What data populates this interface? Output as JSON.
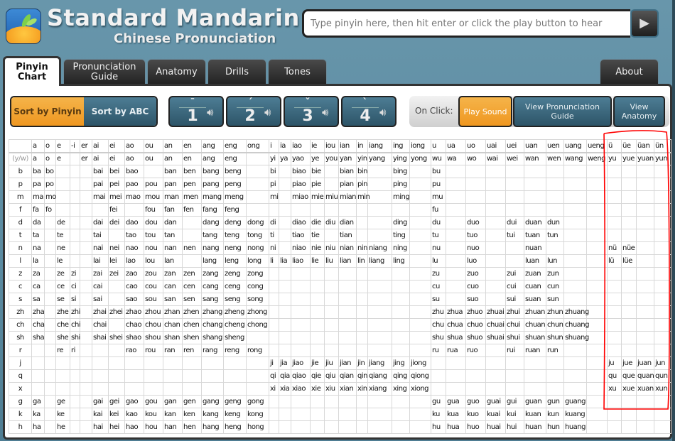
{
  "header": {
    "title": "Standard Mandarin",
    "subtitle": "Chinese Pronunciation",
    "search_placeholder": "Type pinyin here, then hit enter or click the play button to hear",
    "play_icon": "play-icon"
  },
  "tabs": [
    {
      "label": "Pinyin Chart",
      "active": true
    },
    {
      "label": "Pronunciation Guide"
    },
    {
      "label": "Anatomy"
    },
    {
      "label": "Drills"
    },
    {
      "label": "Tones"
    },
    {
      "label": "About"
    }
  ],
  "sort": {
    "pinyin": "Sort by Pinyin",
    "abc": "Sort by ABC",
    "selected": "pinyin"
  },
  "tones": [
    {
      "mark": "ˉ",
      "num": "1"
    },
    {
      "mark": "ˊ",
      "num": "2"
    },
    {
      "mark": "ˇ",
      "num": "3"
    },
    {
      "mark": "ˋ",
      "num": "4"
    }
  ],
  "on_click": {
    "label": "On Click:",
    "options": [
      "Play Sound",
      "View Pronunciation Guide",
      "View Anatomy"
    ],
    "selected": "Play Sound"
  },
  "colors": {
    "accent": "#ef9720",
    "button_blue": "#3a6679",
    "annotation": "#ff0000"
  },
  "chart": {
    "finals": [
      "a",
      "o",
      "e",
      "-i",
      "er",
      "ai",
      "ei",
      "ao",
      "ou",
      "an",
      "en",
      "ang",
      "eng",
      "ong",
      "i",
      "ia",
      "iao",
      "ie",
      "iou",
      "ian",
      "in",
      "iang",
      "ing",
      "iong",
      "u",
      "ua",
      "uo",
      "uai",
      "uei",
      "uan",
      "uen",
      "uang",
      "ueng",
      "ü",
      "üe",
      "üan",
      "ün"
    ],
    "rows": [
      {
        "initial": "(y/w)",
        "cells": [
          "a",
          "o",
          "e",
          "",
          "er",
          "ai",
          "ei",
          "ao",
          "ou",
          "an",
          "en",
          "ang",
          "eng",
          "",
          "yi",
          "ya",
          "yao",
          "ye",
          "you",
          "yan",
          "yin",
          "yang",
          "ying",
          "yong",
          "wu",
          "wa",
          "wo",
          "wai",
          "wei",
          "wan",
          "wen",
          "wang",
          "weng",
          "yu",
          "yue",
          "yuan",
          "yun"
        ]
      },
      {
        "initial": "b",
        "cells": [
          "ba",
          "bo",
          "",
          "",
          "",
          "bai",
          "bei",
          "bao",
          "",
          "ban",
          "ben",
          "bang",
          "beng",
          "",
          "bi",
          "",
          "biao",
          "bie",
          "",
          "bian",
          "bin",
          "",
          "bing",
          "",
          "bu",
          "",
          "",
          "",
          "",
          "",
          "",
          "",
          "",
          "",
          "",
          "",
          ""
        ]
      },
      {
        "initial": "p",
        "cells": [
          "pa",
          "po",
          "",
          "",
          "",
          "pai",
          "pei",
          "pao",
          "pou",
          "pan",
          "pen",
          "pang",
          "peng",
          "",
          "pi",
          "",
          "piao",
          "pie",
          "",
          "pian",
          "pin",
          "",
          "ping",
          "",
          "pu",
          "",
          "",
          "",
          "",
          "",
          "",
          "",
          "",
          "",
          "",
          "",
          ""
        ]
      },
      {
        "initial": "m",
        "cells": [
          "ma",
          "mo",
          "",
          "",
          "",
          "mai",
          "mei",
          "mao",
          "mou",
          "man",
          "men",
          "mang",
          "meng",
          "",
          "mi",
          "",
          "miao",
          "mie",
          "miu",
          "mian",
          "min",
          "",
          "ming",
          "",
          "mu",
          "",
          "",
          "",
          "",
          "",
          "",
          "",
          "",
          "",
          "",
          "",
          ""
        ]
      },
      {
        "initial": "f",
        "cells": [
          "fa",
          "fo",
          "",
          "",
          "",
          "",
          "fei",
          "",
          "fou",
          "fan",
          "fen",
          "fang",
          "feng",
          "",
          "",
          "",
          "",
          "",
          "",
          "",
          "",
          "",
          "",
          "",
          "fu",
          "",
          "",
          "",
          "",
          "",
          "",
          "",
          "",
          "",
          "",
          "",
          ""
        ]
      },
      {
        "initial": "d",
        "cells": [
          "da",
          "",
          "de",
          "",
          "",
          "dai",
          "dei",
          "dao",
          "dou",
          "dan",
          "",
          "dang",
          "deng",
          "dong",
          "di",
          "",
          "diao",
          "die",
          "diu",
          "dian",
          "",
          "",
          "ding",
          "",
          "du",
          "",
          "duo",
          "",
          "dui",
          "duan",
          "dun",
          "",
          "",
          "",
          "",
          "",
          ""
        ]
      },
      {
        "initial": "t",
        "cells": [
          "ta",
          "",
          "te",
          "",
          "",
          "tai",
          "",
          "tao",
          "tou",
          "tan",
          "",
          "tang",
          "teng",
          "tong",
          "ti",
          "",
          "tiao",
          "tie",
          "",
          "tian",
          "",
          "",
          "ting",
          "",
          "tu",
          "",
          "tuo",
          "",
          "tui",
          "tuan",
          "tun",
          "",
          "",
          "",
          "",
          "",
          ""
        ]
      },
      {
        "initial": "n",
        "cells": [
          "na",
          "",
          "ne",
          "",
          "",
          "nai",
          "nei",
          "nao",
          "nou",
          "nan",
          "nen",
          "nang",
          "neng",
          "nong",
          "ni",
          "",
          "niao",
          "nie",
          "niu",
          "nian",
          "nin",
          "niang",
          "ning",
          "",
          "nu",
          "",
          "nuo",
          "",
          "",
          "nuan",
          "",
          "",
          "",
          "nü",
          "nüe",
          "",
          ""
        ]
      },
      {
        "initial": "l",
        "cells": [
          "la",
          "",
          "le",
          "",
          "",
          "lai",
          "lei",
          "lao",
          "lou",
          "lan",
          "",
          "lang",
          "leng",
          "long",
          "li",
          "lia",
          "liao",
          "lie",
          "liu",
          "lian",
          "lin",
          "liang",
          "ling",
          "",
          "lu",
          "",
          "luo",
          "",
          "",
          "luan",
          "lun",
          "",
          "",
          "lü",
          "lüe",
          "",
          ""
        ]
      },
      {
        "initial": "z",
        "cells": [
          "za",
          "",
          "ze",
          "zi",
          "",
          "zai",
          "zei",
          "zao",
          "zou",
          "zan",
          "zen",
          "zang",
          "zeng",
          "zong",
          "",
          "",
          "",
          "",
          "",
          "",
          "",
          "",
          "",
          "",
          "zu",
          "",
          "zuo",
          "",
          "zui",
          "zuan",
          "zun",
          "",
          "",
          "",
          "",
          "",
          ""
        ]
      },
      {
        "initial": "c",
        "cells": [
          "ca",
          "",
          "ce",
          "ci",
          "",
          "cai",
          "",
          "cao",
          "cou",
          "can",
          "cen",
          "cang",
          "ceng",
          "cong",
          "",
          "",
          "",
          "",
          "",
          "",
          "",
          "",
          "",
          "",
          "cu",
          "",
          "cuo",
          "",
          "cui",
          "cuan",
          "cun",
          "",
          "",
          "",
          "",
          "",
          ""
        ]
      },
      {
        "initial": "s",
        "cells": [
          "sa",
          "",
          "se",
          "si",
          "",
          "sai",
          "",
          "sao",
          "sou",
          "san",
          "sen",
          "sang",
          "seng",
          "song",
          "",
          "",
          "",
          "",
          "",
          "",
          "",
          "",
          "",
          "",
          "su",
          "",
          "suo",
          "",
          "sui",
          "suan",
          "sun",
          "",
          "",
          "",
          "",
          "",
          ""
        ]
      },
      {
        "initial": "zh",
        "cells": [
          "zha",
          "",
          "zhe",
          "zhi",
          "",
          "zhai",
          "zhei",
          "zhao",
          "zhou",
          "zhan",
          "zhen",
          "zhang",
          "zheng",
          "zhong",
          "",
          "",
          "",
          "",
          "",
          "",
          "",
          "",
          "",
          "",
          "zhu",
          "zhua",
          "zhuo",
          "zhuai",
          "zhui",
          "zhuan",
          "zhun",
          "zhuang",
          "",
          "",
          "",
          "",
          ""
        ]
      },
      {
        "initial": "ch",
        "cells": [
          "cha",
          "",
          "che",
          "chi",
          "",
          "chai",
          "",
          "chao",
          "chou",
          "chan",
          "chen",
          "chang",
          "cheng",
          "chong",
          "",
          "",
          "",
          "",
          "",
          "",
          "",
          "",
          "",
          "",
          "chu",
          "chua",
          "chuo",
          "chuai",
          "chui",
          "chuan",
          "chun",
          "chuang",
          "",
          "",
          "",
          "",
          ""
        ]
      },
      {
        "initial": "sh",
        "cells": [
          "sha",
          "",
          "she",
          "shi",
          "",
          "shai",
          "shei",
          "shao",
          "shou",
          "shan",
          "shen",
          "shang",
          "sheng",
          "",
          "",
          "",
          "",
          "",
          "",
          "",
          "",
          "",
          "",
          "",
          "shu",
          "shua",
          "shuo",
          "shuai",
          "shui",
          "shuan",
          "shun",
          "shuang",
          "",
          "",
          "",
          "",
          ""
        ]
      },
      {
        "initial": "r",
        "cells": [
          "",
          "",
          "re",
          "ri",
          "",
          "",
          "",
          "rao",
          "rou",
          "ran",
          "ren",
          "rang",
          "reng",
          "rong",
          "",
          "",
          "",
          "",
          "",
          "",
          "",
          "",
          "",
          "",
          "ru",
          "rua",
          "ruo",
          "",
          "rui",
          "ruan",
          "run",
          "",
          "",
          "",
          "",
          "",
          ""
        ]
      },
      {
        "initial": "j",
        "cells": [
          "",
          "",
          "",
          "",
          "",
          "",
          "",
          "",
          "",
          "",
          "",
          "",
          "",
          "",
          "ji",
          "jia",
          "jiao",
          "jie",
          "jiu",
          "jian",
          "jin",
          "jiang",
          "jing",
          "jiong",
          "",
          "",
          "",
          "",
          "",
          "",
          "",
          "",
          "",
          "ju",
          "jue",
          "juan",
          "jun"
        ]
      },
      {
        "initial": "q",
        "cells": [
          "",
          "",
          "",
          "",
          "",
          "",
          "",
          "",
          "",
          "",
          "",
          "",
          "",
          "",
          "qi",
          "qia",
          "qiao",
          "qie",
          "qiu",
          "qian",
          "qin",
          "qiang",
          "qing",
          "qiong",
          "",
          "",
          "",
          "",
          "",
          "",
          "",
          "",
          "",
          "qu",
          "que",
          "quan",
          "qun"
        ]
      },
      {
        "initial": "x",
        "cells": [
          "",
          "",
          "",
          "",
          "",
          "",
          "",
          "",
          "",
          "",
          "",
          "",
          "",
          "",
          "xi",
          "xia",
          "xiao",
          "xie",
          "xiu",
          "xian",
          "xin",
          "xiang",
          "xing",
          "xiong",
          "",
          "",
          "",
          "",
          "",
          "",
          "",
          "",
          "",
          "xu",
          "xue",
          "xuan",
          "xun"
        ]
      },
      {
        "initial": "g",
        "cells": [
          "ga",
          "",
          "ge",
          "",
          "",
          "gai",
          "gei",
          "gao",
          "gou",
          "gan",
          "gen",
          "gang",
          "geng",
          "gong",
          "",
          "",
          "",
          "",
          "",
          "",
          "",
          "",
          "",
          "",
          "gu",
          "gua",
          "guo",
          "guai",
          "gui",
          "guan",
          "gun",
          "guang",
          "",
          "",
          "",
          "",
          ""
        ]
      },
      {
        "initial": "k",
        "cells": [
          "ka",
          "",
          "ke",
          "",
          "",
          "kai",
          "kei",
          "kao",
          "kou",
          "kan",
          "ken",
          "kang",
          "keng",
          "kong",
          "",
          "",
          "",
          "",
          "",
          "",
          "",
          "",
          "",
          "",
          "ku",
          "kua",
          "kuo",
          "kuai",
          "kui",
          "kuan",
          "kun",
          "kuang",
          "",
          "",
          "",
          "",
          ""
        ]
      },
      {
        "initial": "h",
        "cells": [
          "ha",
          "",
          "he",
          "",
          "",
          "hai",
          "hei",
          "hao",
          "hou",
          "han",
          "hen",
          "hang",
          "heng",
          "hong",
          "",
          "",
          "",
          "",
          "",
          "",
          "",
          "",
          "",
          "",
          "hu",
          "hua",
          "huo",
          "huai",
          "hui",
          "huan",
          "hun",
          "huang",
          "",
          "",
          "",
          "",
          ""
        ]
      }
    ]
  }
}
